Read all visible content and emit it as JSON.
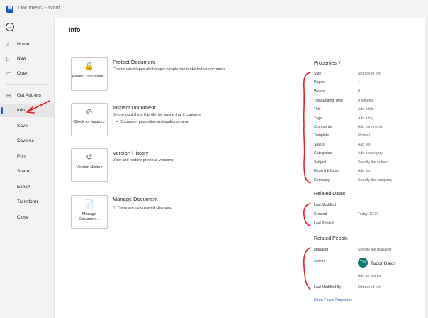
{
  "window": {
    "title": "Document2 - Word",
    "logo_letter": "W"
  },
  "nav": {
    "back_icon": "back-arrow-icon",
    "items": [
      {
        "label": "Home"
      },
      {
        "label": "New"
      },
      {
        "label": "Open"
      },
      {
        "label": "Get Add-ins"
      },
      {
        "label": "Info"
      },
      {
        "label": "Save"
      },
      {
        "label": "Save As"
      },
      {
        "label": "Print"
      },
      {
        "label": "Share"
      },
      {
        "label": "Export"
      },
      {
        "label": "Transform"
      },
      {
        "label": "Close"
      }
    ],
    "active": "Info"
  },
  "page": {
    "title": "Info"
  },
  "sections": [
    {
      "button_label": "Protect Document",
      "button_caret": "⌄",
      "title": "Protect Document",
      "description": "Control what types of changes people can make to this document."
    },
    {
      "button_label": "Check for Issues",
      "button_caret": "⌄",
      "title": "Inspect Document",
      "description": "Before publishing this file, be aware that it contains:",
      "bullet": "Document properties and author's name"
    },
    {
      "button_label": "Version History",
      "title": "Version History",
      "description": "View and restore previous versions."
    },
    {
      "button_label": "Manage Document",
      "button_caret": "⌄",
      "title": "Manage Document",
      "description": "There are no unsaved changes."
    }
  ],
  "properties": {
    "heading": "Properties ˅",
    "rows": [
      {
        "k": "Size",
        "v": "Not saved yet"
      },
      {
        "k": "Pages",
        "v": "1"
      },
      {
        "k": "Words",
        "v": "0"
      },
      {
        "k": "Total Editing Time",
        "v": "0 Minutes"
      },
      {
        "k": "Title",
        "v": "Add a title"
      },
      {
        "k": "Tags",
        "v": "Add a tag"
      },
      {
        "k": "Comments",
        "v": "Add comments"
      },
      {
        "k": "Template",
        "v": "Normal"
      },
      {
        "k": "Status",
        "v": "Add text"
      },
      {
        "k": "Categories",
        "v": "Add a category"
      },
      {
        "k": "Subject",
        "v": "Specify the subject"
      },
      {
        "k": "Hyperlink Base",
        "v": "Add text"
      },
      {
        "k": "Company",
        "v": "Specify the company"
      }
    ]
  },
  "related_dates": {
    "heading": "Related Dates",
    "rows": [
      {
        "k": "Last Modified",
        "v": ""
      },
      {
        "k": "Created",
        "v": "Today, 10:30"
      },
      {
        "k": "Last Printed",
        "v": ""
      }
    ]
  },
  "related_people": {
    "heading": "Related People",
    "manager_label": "Manager",
    "manager_value": "Specify the manager",
    "author_label": "Author",
    "author_initials": "TG",
    "author_name": "Tudor Galos",
    "add_author": "Add an author",
    "last_modified_by_label": "Last Modified By",
    "last_modified_by_value": "Not saved yet"
  },
  "show_fewer": "Show Fewer Properties",
  "annotation_color": "#e0202a",
  "accent_color": "#185abd"
}
